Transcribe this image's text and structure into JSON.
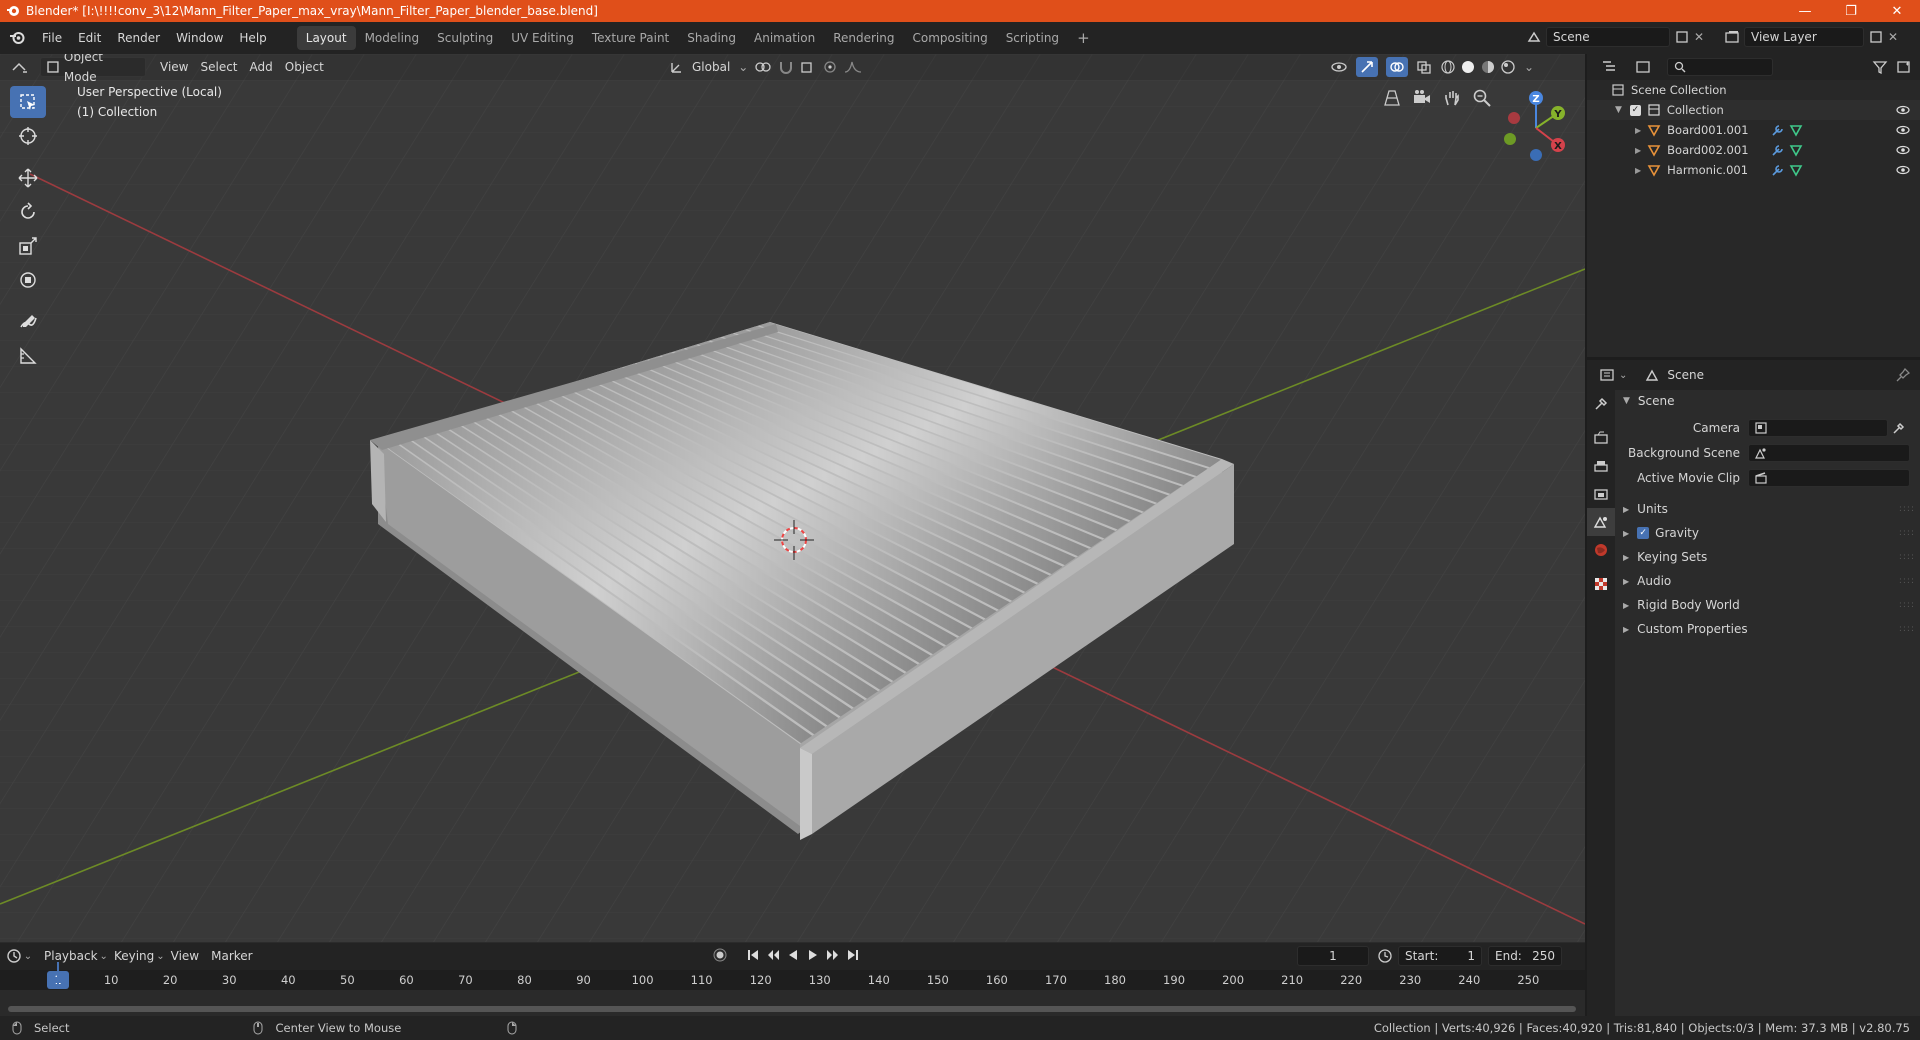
{
  "window": {
    "title": "Blender* [I:\\!!!!conv_3\\12\\Mann_Filter_Paper_max_vray\\Mann_Filter_Paper_blender_base.blend]",
    "minimize": "—",
    "maximize": "❐",
    "close": "✕"
  },
  "menu": [
    "File",
    "Edit",
    "Render",
    "Window",
    "Help"
  ],
  "workspaces": [
    "Layout",
    "Modeling",
    "Sculpting",
    "UV Editing",
    "Texture Paint",
    "Shading",
    "Animation",
    "Rendering",
    "Compositing",
    "Scripting"
  ],
  "workspace_add": "+",
  "scene_field": "Scene",
  "view_layer_field": "View Layer",
  "viewport": {
    "mode": "Object Mode",
    "menus": [
      "View",
      "Select",
      "Add",
      "Object"
    ],
    "orientation": "Global",
    "info_line1": "User Perspective (Local)",
    "info_line2": "(1) Collection",
    "gizmo": {
      "z": "Z",
      "y": "Y",
      "x": "X"
    }
  },
  "timeline": {
    "menus": [
      "Playback",
      "Keying",
      "View",
      "Marker"
    ],
    "current_frame": "1",
    "start_label": "Start:",
    "start": "1",
    "end_label": "End:",
    "end": "250",
    "ticks": [
      "1",
      "10",
      "20",
      "30",
      "40",
      "50",
      "60",
      "70",
      "80",
      "90",
      "100",
      "110",
      "120",
      "130",
      "140",
      "150",
      "160",
      "170",
      "180",
      "190",
      "200",
      "210",
      "220",
      "230",
      "240",
      "250"
    ]
  },
  "outliner": {
    "root": "Scene Collection",
    "collection": "Collection",
    "objects": [
      "Board001.001",
      "Board002.001",
      "Harmonic.001"
    ]
  },
  "properties": {
    "header": "Scene",
    "panel": "Scene",
    "camera_label": "Camera",
    "background_scene_label": "Background Scene",
    "active_movie_clip_label": "Active Movie Clip",
    "sections": [
      "Units",
      "Gravity",
      "Keying Sets",
      "Audio",
      "Rigid Body World",
      "Custom Properties"
    ]
  },
  "status": {
    "select": "Select",
    "center_view": "Center View to Mouse",
    "stats": "Collection | Verts:40,926 | Faces:40,920 | Tris:81,840 | Objects:0/3 | Mem: 37.3 MB | v2.80.75"
  },
  "colors": {
    "title_bar": "#e04f1a",
    "accent": "#4772b3",
    "x_axis": "#d4424b",
    "y_axis": "#86b22b",
    "z_axis": "#4a87e0"
  }
}
